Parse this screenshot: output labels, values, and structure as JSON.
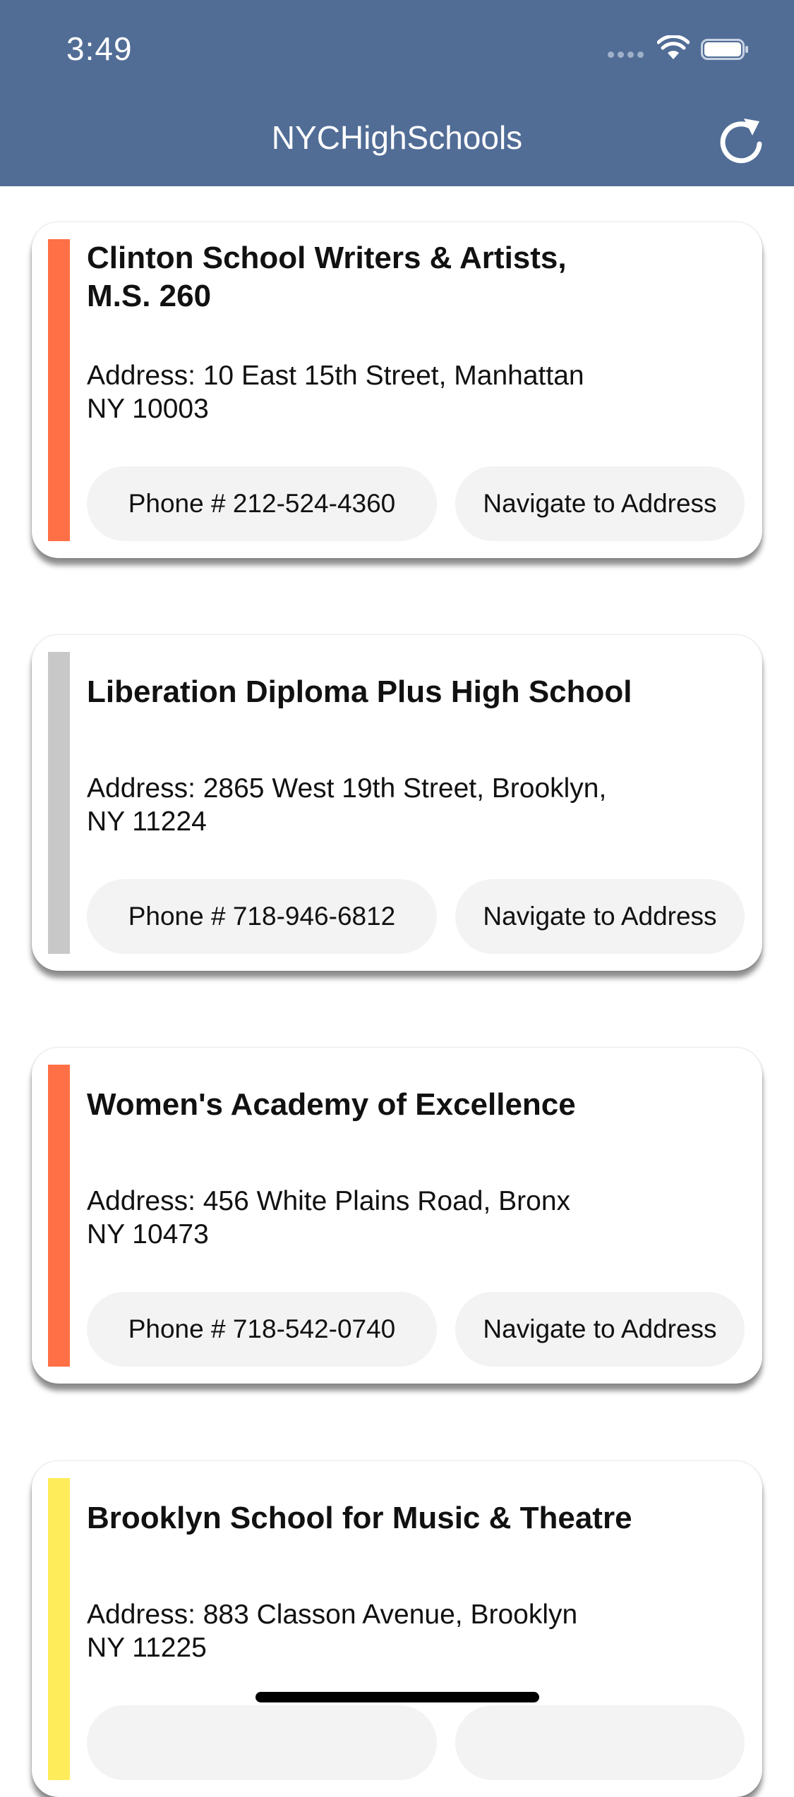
{
  "status_bar": {
    "time": "3:49"
  },
  "nav": {
    "title": "NYCHighSchools",
    "refresh_icon": "refresh-icon"
  },
  "schools": [
    {
      "name_lines": [
        "Clinton School Writers & Artists,",
        "M.S. 260"
      ],
      "address_lines": [
        "Address: 10 East 15th Street, Manhattan",
        "NY 10003"
      ],
      "phone_label": "Phone # 212-524-4360",
      "navigate_label": "Navigate to Address",
      "accent_color": "#ff7046"
    },
    {
      "name_lines": [
        "Liberation Diploma Plus High School"
      ],
      "address_lines": [
        "Address: 2865 West 19th Street, Brooklyn,",
        "NY 11224"
      ],
      "phone_label": "Phone # 718-946-6812",
      "navigate_label": "Navigate to Address",
      "accent_color": "#c8c8c8"
    },
    {
      "name_lines": [
        "Women's Academy of Excellence"
      ],
      "address_lines": [
        "Address: 456 White Plains Road, Bronx",
        "NY 10473"
      ],
      "phone_label": "Phone # 718-542-0740",
      "navigate_label": "Navigate to Address",
      "accent_color": "#ff7046"
    },
    {
      "name_lines": [
        "Brooklyn School for Music & Theatre"
      ],
      "address_lines": [
        "Address: 883 Classon Avenue, Brooklyn",
        "NY 11225"
      ],
      "phone_label": "",
      "navigate_label": "",
      "accent_color": "#ffec5a"
    }
  ],
  "colors": {
    "nav_bar": "#516d96",
    "pill_bg": "#f3f3f3",
    "text": "#111111"
  }
}
